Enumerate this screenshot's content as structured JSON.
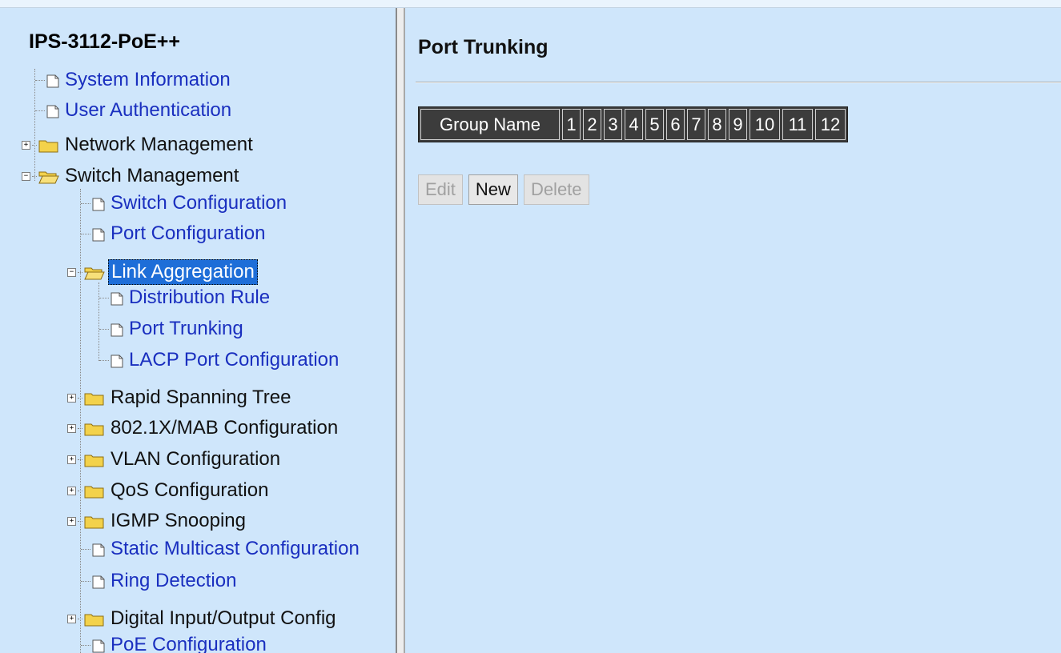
{
  "tree": {
    "title": "IPS-3112-PoE++",
    "items": [
      {
        "label": "System Information",
        "kind": "page"
      },
      {
        "label": "User Authentication",
        "kind": "page"
      },
      {
        "label": "Network Management",
        "kind": "folder",
        "state": "collapsed"
      },
      {
        "label": "Switch Management",
        "kind": "folder",
        "state": "expanded"
      },
      {
        "label": "Switch Configuration",
        "kind": "page"
      },
      {
        "label": "Port Configuration",
        "kind": "page"
      },
      {
        "label": "Link Aggregation",
        "kind": "folder",
        "state": "expanded",
        "selected": true
      },
      {
        "label": "Distribution Rule",
        "kind": "page"
      },
      {
        "label": "Port Trunking",
        "kind": "page"
      },
      {
        "label": "LACP Port Configuration",
        "kind": "page"
      },
      {
        "label": "Rapid Spanning Tree",
        "kind": "folder",
        "state": "collapsed"
      },
      {
        "label": "802.1X/MAB Configuration",
        "kind": "folder",
        "state": "collapsed"
      },
      {
        "label": "VLAN Configuration",
        "kind": "folder",
        "state": "collapsed"
      },
      {
        "label": "QoS Configuration",
        "kind": "folder",
        "state": "collapsed"
      },
      {
        "label": "IGMP Snooping",
        "kind": "folder",
        "state": "collapsed"
      },
      {
        "label": "Static Multicast Configuration",
        "kind": "page"
      },
      {
        "label": "Ring Detection",
        "kind": "page"
      },
      {
        "label": "Digital Input/Output Config",
        "kind": "folder",
        "state": "collapsed"
      },
      {
        "label": "PoE Configuration",
        "kind": "page"
      }
    ]
  },
  "main": {
    "title": "Port Trunking",
    "table_headers": [
      "Group Name",
      "1",
      "2",
      "3",
      "4",
      "5",
      "6",
      "7",
      "8",
      "9",
      "10",
      "11",
      "12"
    ],
    "buttons": {
      "edit": "Edit",
      "new": "New",
      "delete": "Delete"
    }
  },
  "colors": {
    "background": "#cfe6fb",
    "link": "#1a2fbf",
    "selection": "#1e6ed8",
    "table_header": "#3c3c3c"
  },
  "icons": {
    "page": "document-icon",
    "folder": "folder-icon",
    "expand": "plus-box",
    "collapse": "minus-box"
  }
}
